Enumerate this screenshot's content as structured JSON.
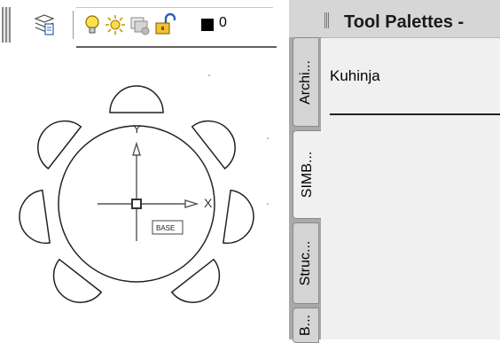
{
  "layer_toolbar": {
    "icons": [
      "layer-properties-icon",
      "lightbulb-on-icon",
      "sun-freeze-icon",
      "layer-viewport-icon",
      "unlock-icon"
    ],
    "color": "#000000",
    "layer_name": "0"
  },
  "drawing": {
    "ucs_y_label": "Y",
    "ucs_x_label": "X",
    "base_block_label": "BASE"
  },
  "palette": {
    "title": "Tool Palettes -",
    "group_label": "Kuhinja",
    "tabs": [
      {
        "label": "Archi..."
      },
      {
        "label": "SIMB..."
      },
      {
        "label": "Struc..."
      },
      {
        "label": "B..."
      }
    ],
    "active_tab": "SIMB..."
  }
}
